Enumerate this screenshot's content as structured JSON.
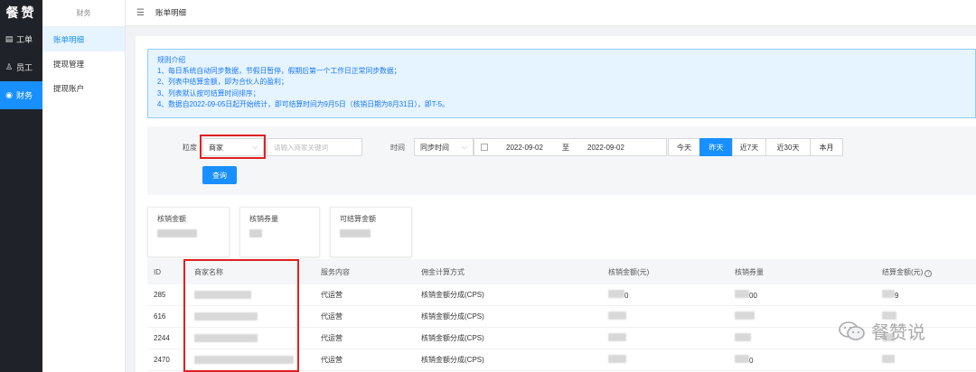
{
  "app": {
    "logo": "餐赞"
  },
  "rail": {
    "items": [
      {
        "label": "工单",
        "icon": "▤"
      },
      {
        "label": "员工",
        "icon": "♙"
      },
      {
        "label": "财务",
        "icon": "◉"
      }
    ]
  },
  "submenu": {
    "title": "财务",
    "items": [
      {
        "label": "账单明细"
      },
      {
        "label": "提现管理"
      },
      {
        "label": "提现账户"
      }
    ]
  },
  "topbar": {
    "fold_icon": "☰",
    "breadcrumb": "账单明细"
  },
  "notice": {
    "title": "规则介绍",
    "lines": [
      "1、每日系统自动同步数据，节假日暂停，假期后第一个工作日正常同步数据；",
      "2、列表中结算金额，即为合伙人的盈利；",
      "3、列表默认按可结算时间排序；",
      "4、数据自2022-09-05日起开始统计，即可结算时间为9月5日（核销日期为8月31日），即T-5。"
    ]
  },
  "filter": {
    "granularity_label": "粒度",
    "granularity_value": "商家",
    "keyword_placeholder": "请输入商家关键词",
    "time_label": "时间",
    "time_type": "同步时间",
    "date_start": "2022-09-02",
    "date_sep": "至",
    "date_end": "2022-09-02",
    "quick_ranges": [
      "今天",
      "昨天",
      "近7天",
      "近30天",
      "本月"
    ],
    "active_range": "昨天",
    "query_button": "查询"
  },
  "stats": [
    {
      "label": "核销金额"
    },
    {
      "label": "核销券量"
    },
    {
      "label": "可结算金额"
    }
  ],
  "table": {
    "headers": [
      "ID",
      "商家名称",
      "服务内容",
      "佣金计算方式",
      "核销金额(元)",
      "核销券量",
      "结算金额(元)"
    ],
    "rows": [
      {
        "id": "285",
        "service": "代运营",
        "method": "核销金额分成(CPS)",
        "amount_tail": "0",
        "count_tail": "00",
        "settle_tail": "9"
      },
      {
        "id": "616",
        "service": "代运营",
        "method": "核销金额分成(CPS)",
        "amount_tail": "",
        "count_tail": "",
        "settle_tail": ""
      },
      {
        "id": "2244",
        "service": "代运营",
        "method": "核销金额分成(CPS)",
        "amount_tail": "",
        "count_tail": "",
        "settle_tail": ""
      },
      {
        "id": "2470",
        "service": "代运营",
        "method": "核销金额分成(CPS)",
        "amount_tail": "",
        "count_tail": "0",
        "settle_tail": ""
      }
    ]
  },
  "watermark": {
    "text": "餐赞说"
  },
  "colors": {
    "accent": "#1890ff",
    "highlight": "#e02020",
    "rail_bg": "#1f2228"
  }
}
